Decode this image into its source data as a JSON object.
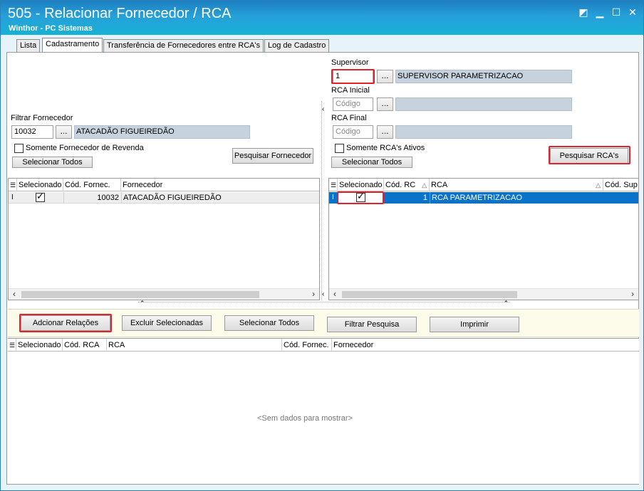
{
  "window": {
    "title": "505 - Relacionar Fornecedor / RCA",
    "subtitle": "Winthor - PC Sistemas",
    "controls": {
      "restore": "◩",
      "minimize": "▁",
      "maximize": "☐",
      "close": "✕"
    }
  },
  "tabs": [
    {
      "label": "Lista"
    },
    {
      "label": "Cadastramento"
    },
    {
      "label": "Transferência de Fornecedores entre RCA's"
    },
    {
      "label": "Log de Cadastro"
    }
  ],
  "left": {
    "filter_label": "Filtrar Fornecedor",
    "filter_code": "10032",
    "filter_name": "ATACADÃO FIGUEIREDÃO",
    "dots": "...",
    "revenda_label": "Somente Fornecedor de Revenda",
    "select_all": "Selecionar Todos",
    "search_button": "Pesquisar Fornecedor",
    "grid": {
      "headers": [
        "Selecionado",
        "Cód. Fornec.",
        "Fornecedor"
      ],
      "rows": [
        {
          "selected": true,
          "code": "10032",
          "name": "ATACADÃO FIGUEIREDÃO"
        }
      ]
    }
  },
  "right": {
    "supervisor_label": "Supervisor",
    "supervisor_code": "1",
    "supervisor_name": "SUPERVISOR PARAMETRIZACAO",
    "rca_initial_label": "RCA Inicial",
    "rca_final_label": "RCA Final",
    "code_placeholder": "Código",
    "dots": "...",
    "active_label": "Somente RCA's Ativos",
    "select_all": "Selecionar Todos",
    "search_button": "Pesquisar RCA's",
    "grid": {
      "headers": [
        "Selecionado",
        "Cód. RC",
        "RCA",
        "Cód. Sup"
      ],
      "rows": [
        {
          "selected": true,
          "code": "1",
          "name": "RCA PARAMETRIZACAO"
        }
      ]
    }
  },
  "actions": {
    "add": "Adcionar Relações",
    "delete": "Excluir Selecionadas",
    "select_all": "Selecionar Todos",
    "filter": "Filtrar Pesquisa",
    "print": "Imprimir"
  },
  "bottom_grid": {
    "headers": [
      "Selecionado",
      "Cód. RCA",
      "RCA",
      "Cód. Fornec.",
      "Fornecedor"
    ],
    "empty": "<Sem dados para mostrar>"
  },
  "colors": {
    "titlebar": "#1d7fc1",
    "highlight": "#e0232a",
    "selected_row": "#0b72c9"
  }
}
